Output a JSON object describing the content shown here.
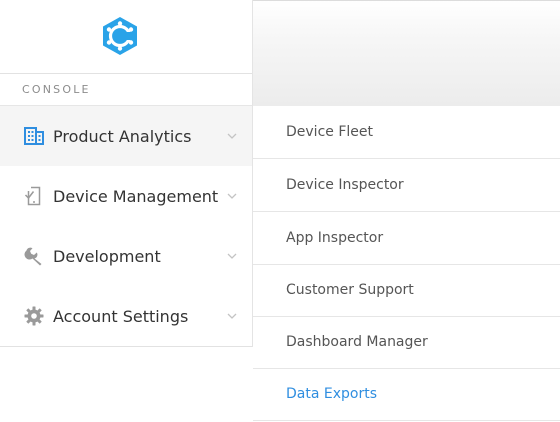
{
  "brand": {
    "logo_icon": "hexagon-c-logo-icon",
    "accent": "#2aa3e8"
  },
  "section": {
    "label": "CONSOLE"
  },
  "nav": {
    "items": [
      {
        "label": "Product Analytics",
        "icon": "building-icon",
        "icon_color": "#2f8ee0",
        "active": true
      },
      {
        "label": "Device Management",
        "icon": "tablet-check-icon",
        "icon_color": "#9a9a9a",
        "active": false
      },
      {
        "label": "Development",
        "icon": "wrench-icon",
        "icon_color": "#9a9a9a",
        "active": false
      },
      {
        "label": "Account Settings",
        "icon": "gear-icon",
        "icon_color": "#9a9a9a",
        "active": false
      }
    ]
  },
  "submenu": {
    "items": [
      {
        "label": "Device Fleet"
      },
      {
        "label": "Device Inspector"
      },
      {
        "label": "App Inspector"
      },
      {
        "label": "Customer Support"
      },
      {
        "label": "Dashboard Manager"
      },
      {
        "label": "Data Exports",
        "highlight": true
      }
    ]
  }
}
